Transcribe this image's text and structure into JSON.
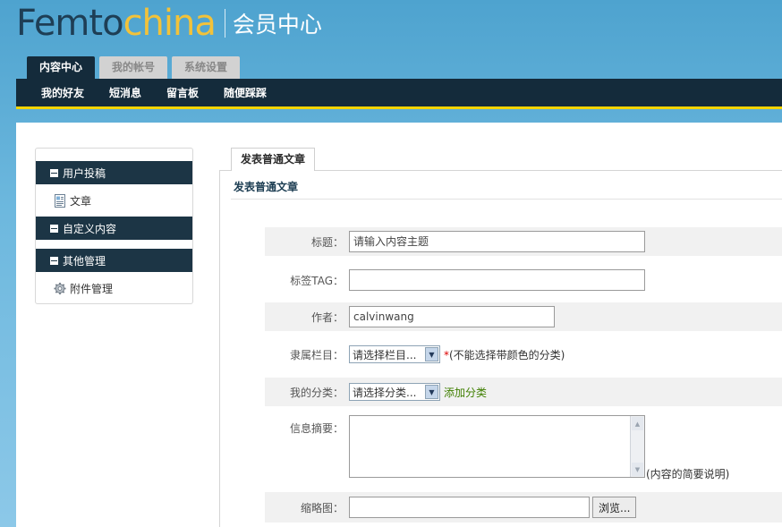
{
  "header": {
    "logo_part1": "Femto",
    "logo_part2": "china",
    "subtitle": "会员中心"
  },
  "tabs": [
    {
      "label": "内容中心",
      "active": true
    },
    {
      "label": "我的帐号",
      "active": false
    },
    {
      "label": "系统设置",
      "active": false
    }
  ],
  "subnav": [
    "我的好友",
    "短消息",
    "留言板",
    "随便踩踩"
  ],
  "sidebar": {
    "sections": [
      {
        "title": "用户投稿",
        "items": [
          {
            "label": "文章",
            "icon": "document-icon"
          }
        ]
      },
      {
        "title": "自定义内容",
        "items": []
      },
      {
        "title": "其他管理",
        "items": [
          {
            "label": "附件管理",
            "icon": "gear-icon"
          }
        ]
      }
    ]
  },
  "main": {
    "tab_label": "发表普通文章",
    "section_title": "发表普通文章"
  },
  "form": {
    "title": {
      "label": "标题：",
      "value": "请输入内容主题"
    },
    "tag": {
      "label": "标签TAG：",
      "value": ""
    },
    "author": {
      "label": "作者：",
      "value": "calvinwang"
    },
    "column": {
      "label": "隶属栏目：",
      "selected": "请选择栏目...",
      "note_star": "*",
      "note": "(不能选择带颜色的分类)"
    },
    "category": {
      "label": "我的分类：",
      "selected": "请选择分类...",
      "link": "添加分类"
    },
    "summary": {
      "label": "信息摘要：",
      "value": "",
      "note": "(内容的简要说明)"
    },
    "thumb": {
      "label": "缩略图：",
      "value": "",
      "browse": "浏览..."
    }
  },
  "colors": {
    "header_bg": "#4ea3cf",
    "nav_bg": "#142b3b",
    "accent_yellow": "#f2d400",
    "logo_yellow": "#f2c23a",
    "link_green": "#3f7f00"
  }
}
